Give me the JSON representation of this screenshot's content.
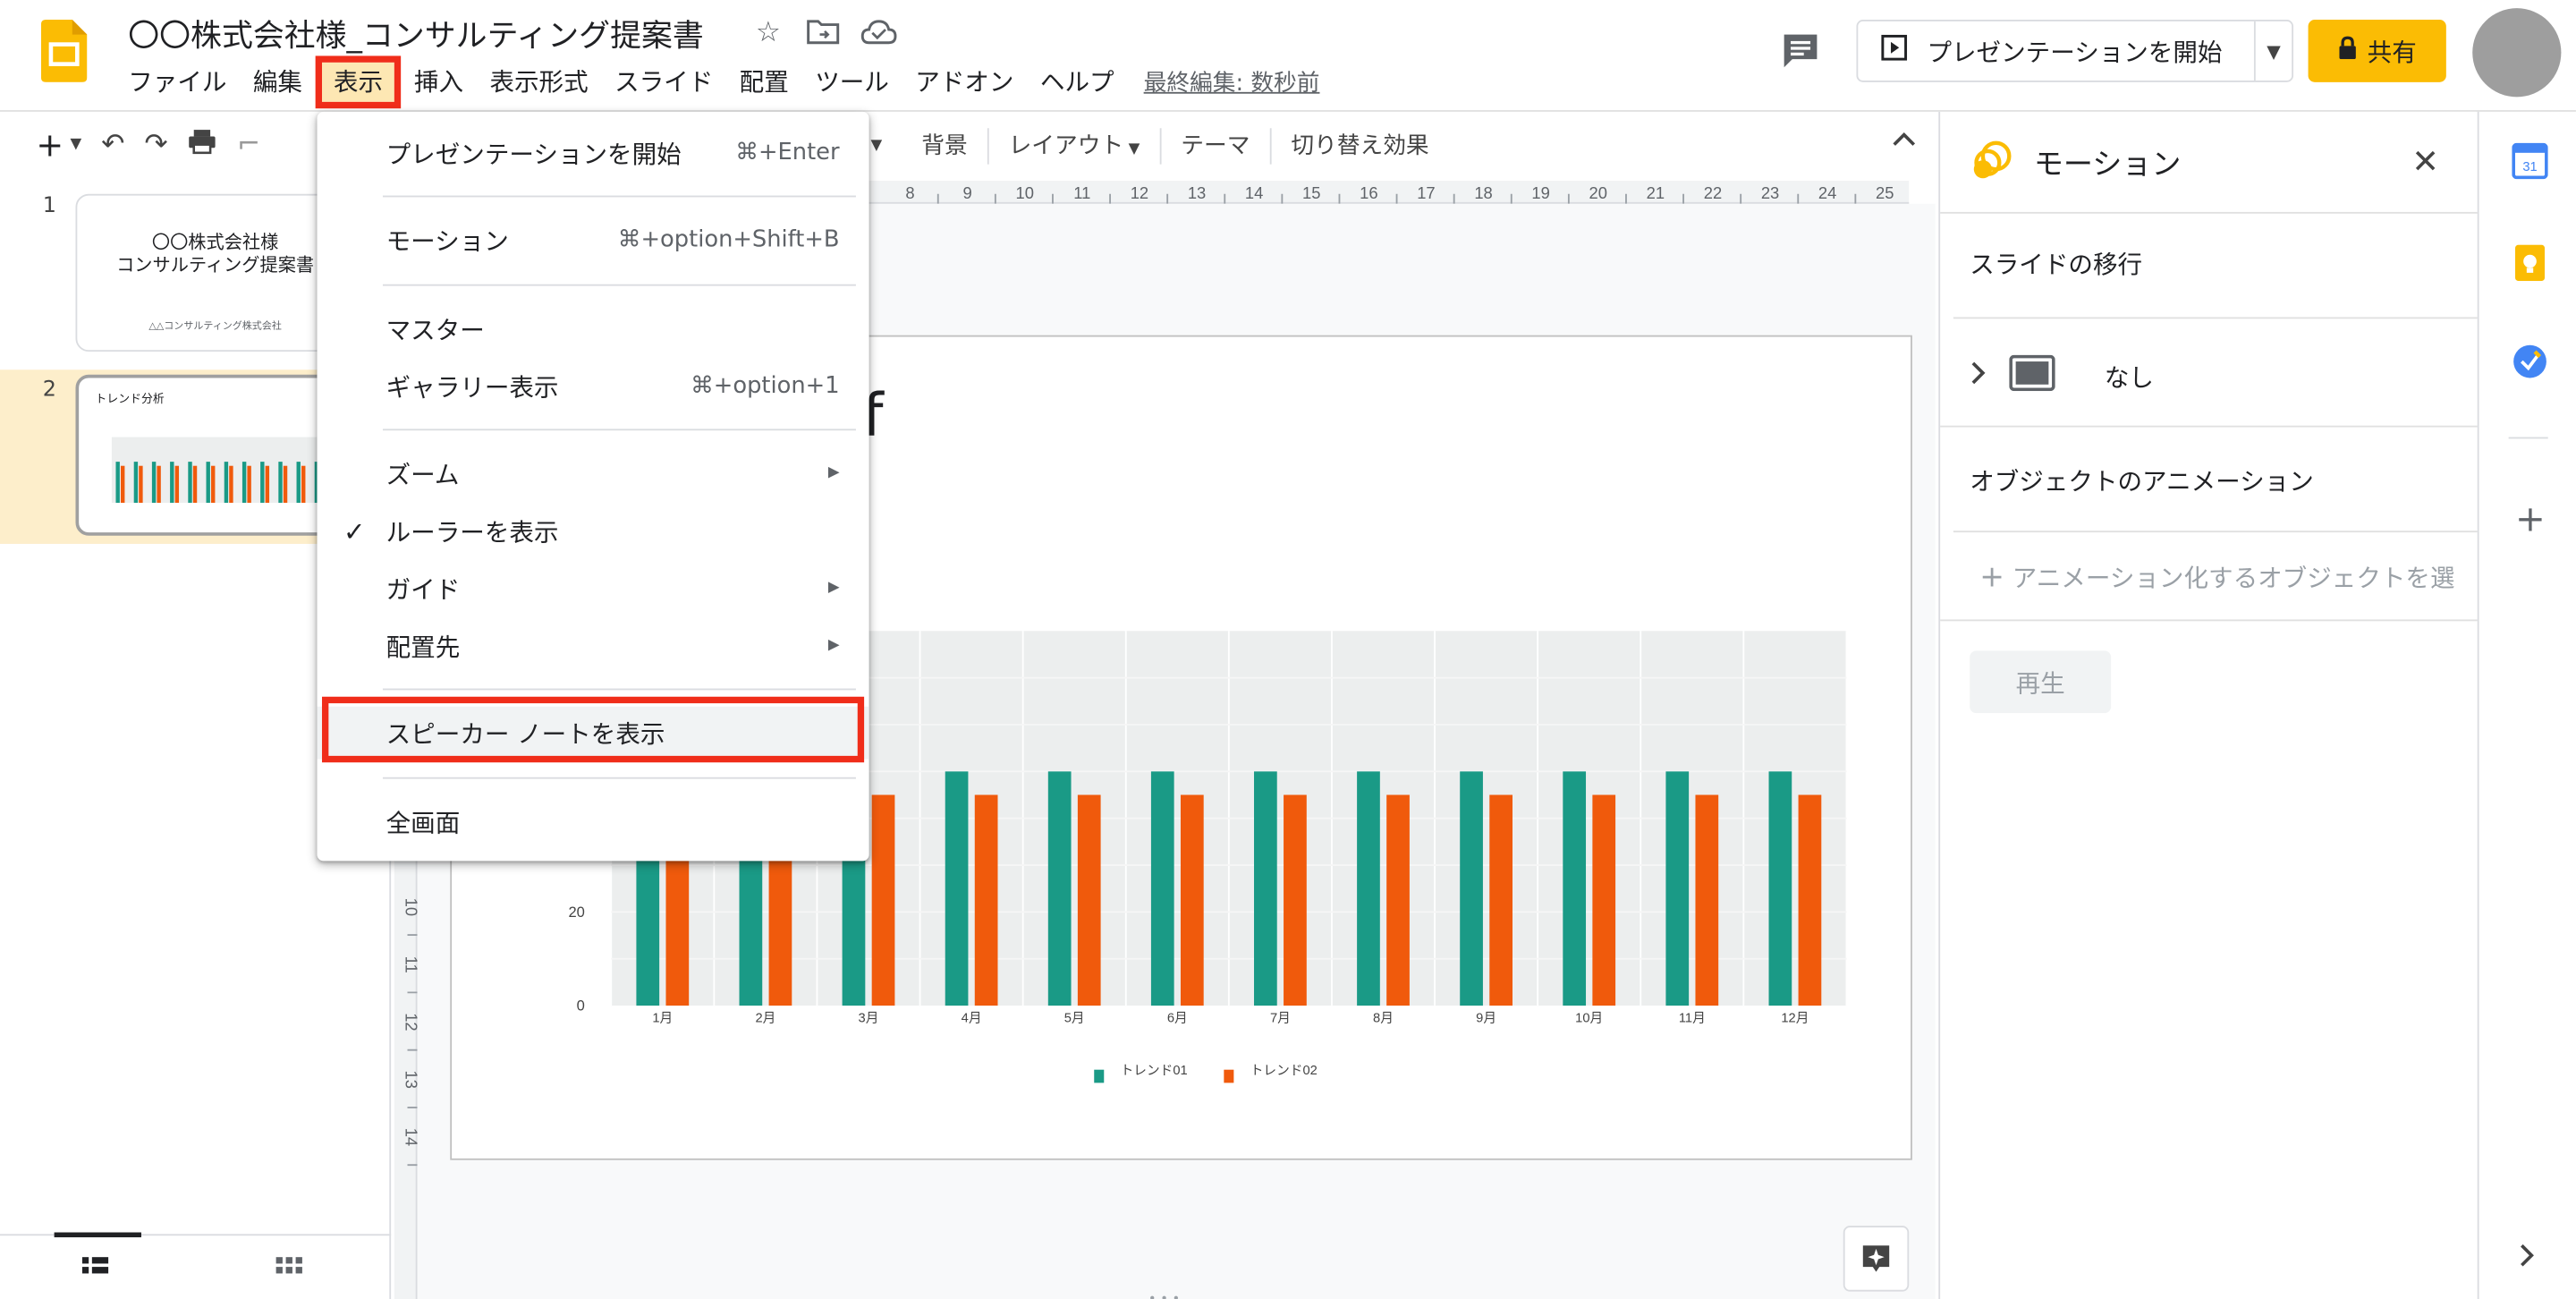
{
  "header": {
    "doc_title": "〇〇株式会社様_コンサルティング提案書",
    "last_edit": "最終編集: 数秒前",
    "present_label": "プレゼンテーションを開始",
    "share_label": "共有"
  },
  "menubar": [
    {
      "label": "ファイル"
    },
    {
      "label": "編集"
    },
    {
      "label": "表示",
      "active": true
    },
    {
      "label": "挿入"
    },
    {
      "label": "表示形式"
    },
    {
      "label": "スライド"
    },
    {
      "label": "配置"
    },
    {
      "label": "ツール"
    },
    {
      "label": "アドオン"
    },
    {
      "label": "ヘルプ"
    }
  ],
  "toolbar": {
    "background": "背景",
    "layout": "レイアウト",
    "theme": "テーマ",
    "transition": "切り替え効果"
  },
  "filmstrip": {
    "slides": [
      {
        "num": "1",
        "title_line1": "〇〇株式会社様",
        "title_line2": "コンサルティング提案書",
        "subtitle": "△△コンサルティング株式会社"
      },
      {
        "num": "2",
        "title": "トレンド分析"
      }
    ]
  },
  "view_menu": {
    "items": [
      {
        "label": "プレゼンテーションを開始",
        "shortcut": "⌘+Enter"
      },
      {
        "label": "モーション",
        "shortcut": "⌘+option+Shift+B"
      },
      {
        "label": "マスター"
      },
      {
        "label": "ギャラリー表示",
        "shortcut": "⌘+option+1"
      },
      {
        "label": "ズーム",
        "submenu": true
      },
      {
        "label": "ルーラーを表示",
        "checked": true
      },
      {
        "label": "ガイド",
        "submenu": true
      },
      {
        "label": "配置先",
        "submenu": true
      },
      {
        "label": "スピーカー ノートを表示"
      },
      {
        "label": "全画面"
      }
    ]
  },
  "motion_panel": {
    "title": "モーション",
    "slide_transition": "スライドの移行",
    "transition_value": "なし",
    "object_animation": "オブジェクトのアニメーション",
    "add_animation": "アニメーション化するオブジェクトを選",
    "play": "再生"
  },
  "colors": {
    "accent_yellow": "#fbbc04",
    "highlight_red": "#f02d1a",
    "series1": "#1a9a86",
    "series2": "#f05a0c"
  },
  "chart_data": {
    "type": "bar",
    "categories": [
      "1月",
      "2月",
      "3月",
      "4月",
      "5月",
      "6月",
      "7月",
      "8月",
      "9月",
      "10月",
      "11月",
      "12月"
    ],
    "series": [
      {
        "name": "トレンド01",
        "values": [
          50,
          50,
          50,
          50,
          50,
          50,
          50,
          50,
          50,
          50,
          50,
          50
        ]
      },
      {
        "name": "トレンド02",
        "values": [
          45,
          45,
          45,
          45,
          45,
          45,
          45,
          45,
          45,
          45,
          45,
          45
        ]
      }
    ],
    "yticks": [
      0,
      20
    ],
    "ylim": [
      0,
      80
    ],
    "legend": "bottom",
    "grid": true
  }
}
